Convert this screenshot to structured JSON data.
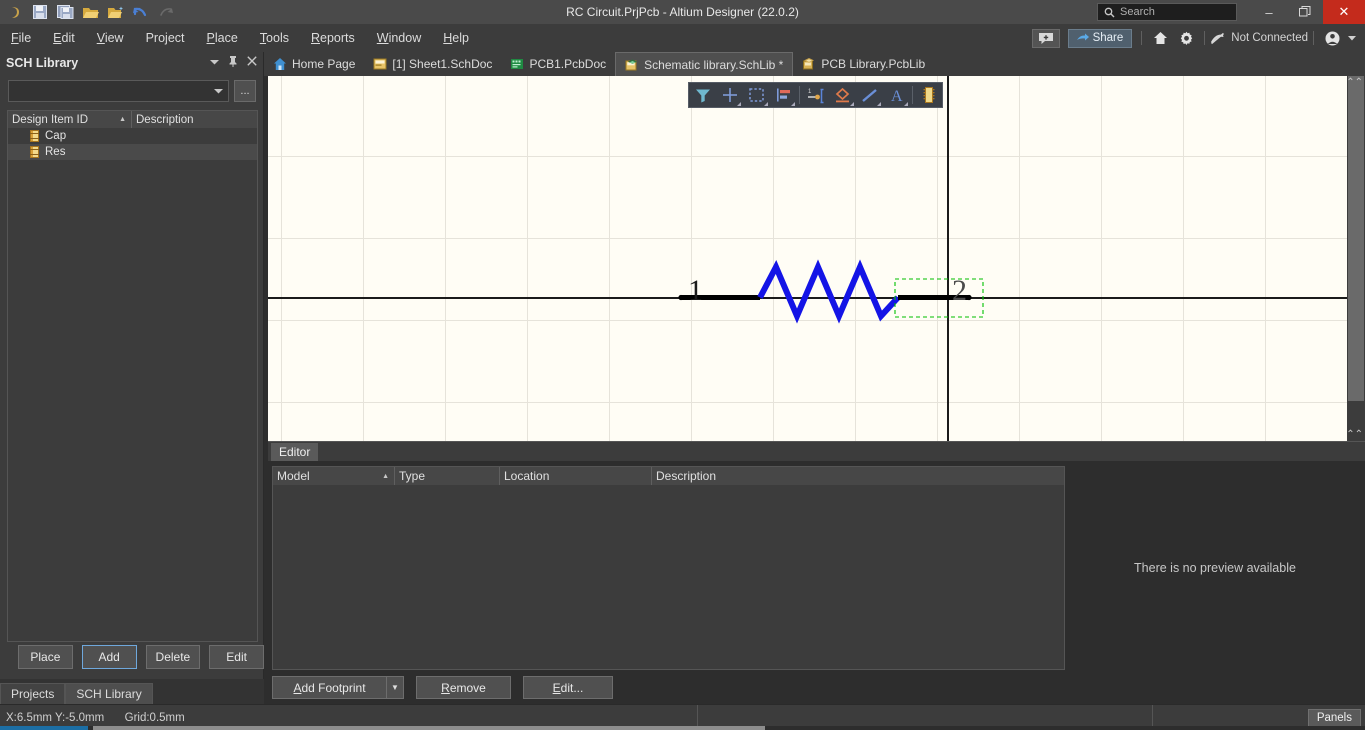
{
  "titlebar": {
    "title": "RC Circuit.PrjPcb - Altium Designer (22.0.2)",
    "search_placeholder": "Search",
    "quick_access": [
      {
        "name": "altium-logo-icon",
        "label": "A"
      },
      {
        "name": "save-icon",
        "label": "Save"
      },
      {
        "name": "save-all-icon",
        "label": "Save All"
      },
      {
        "name": "open-icon",
        "label": "Open"
      },
      {
        "name": "open-project-icon",
        "label": "Open Project"
      },
      {
        "name": "undo-icon",
        "label": "Undo"
      },
      {
        "name": "redo-icon",
        "label": "Redo"
      }
    ],
    "minimize": "–",
    "restore": "❐",
    "close": "✕"
  },
  "menubar": {
    "items": [
      {
        "label": "File",
        "mnemonic": "F"
      },
      {
        "label": "Edit",
        "mnemonic": "E"
      },
      {
        "label": "View",
        "mnemonic": "V"
      },
      {
        "label": "Project",
        "mnemonic": "j"
      },
      {
        "label": "Place",
        "mnemonic": "P"
      },
      {
        "label": "Tools",
        "mnemonic": "T"
      },
      {
        "label": "Reports",
        "mnemonic": "R"
      },
      {
        "label": "Window",
        "mnemonic": "W"
      },
      {
        "label": "Help",
        "mnemonic": "H"
      }
    ],
    "share_label": "Share",
    "connection_status": "Not Connected",
    "icons": [
      "add-panel-icon",
      "share-icon",
      "home-icon",
      "gear-icon",
      "not-connected-icon",
      "account-icon",
      "chevron-down-icon"
    ]
  },
  "tabs": [
    {
      "label": "Home Page",
      "icon": "home-page-icon",
      "active": false
    },
    {
      "label": "[1] Sheet1.SchDoc",
      "icon": "schematic-doc-icon",
      "active": false
    },
    {
      "label": "PCB1.PcbDoc",
      "icon": "pcb-doc-icon",
      "active": false
    },
    {
      "label": "Schematic library.SchLib *",
      "icon": "schlib-icon",
      "active": true
    },
    {
      "label": "PCB Library.PcbLib",
      "icon": "pcblib-icon",
      "active": false
    }
  ],
  "sidebar": {
    "title": "SCH Library",
    "header_icons": [
      "chevron-down-icon",
      "pin-icon",
      "close-icon"
    ],
    "library_select_value": "",
    "ellipsis_label": "...",
    "columns": [
      {
        "label": "Design Item ID",
        "sorted": true
      },
      {
        "label": "Description",
        "sorted": false
      }
    ],
    "items": [
      {
        "label": "Cap",
        "description": "",
        "selected": false
      },
      {
        "label": "Res",
        "description": "",
        "selected": true
      }
    ],
    "buttons": [
      {
        "label": "Place",
        "focused": false
      },
      {
        "label": "Add",
        "focused": true
      },
      {
        "label": "Delete",
        "focused": false
      },
      {
        "label": "Edit",
        "focused": false
      }
    ],
    "tabs": [
      {
        "label": "Projects",
        "active": false
      },
      {
        "label": "SCH Library",
        "active": true
      }
    ]
  },
  "canvas": {
    "toolbar_icons": [
      {
        "name": "filter-icon",
        "has_dropdown": false
      },
      {
        "name": "crosshair-place-icon",
        "has_dropdown": true
      },
      {
        "name": "selection-rectangle-icon",
        "has_dropdown": true
      },
      {
        "name": "align-icon",
        "has_dropdown": true
      },
      {
        "name": "place-pin-icon",
        "has_dropdown": false
      },
      {
        "name": "place-polygon-icon",
        "has_dropdown": true
      },
      {
        "name": "place-line-icon",
        "has_dropdown": true
      },
      {
        "name": "place-text-icon",
        "has_dropdown": true
      },
      {
        "name": "place-component-icon",
        "has_dropdown": false
      }
    ],
    "pin_labels": [
      "1",
      "2"
    ],
    "symbol_name": "resistor-symbol",
    "symbol_color": "#1414e6",
    "wire_color": "#000000",
    "selection_color": "#00c000",
    "background": "#fffdf5",
    "grid_color": "#e6e3da"
  },
  "editor": {
    "tab_label": "Editor",
    "model_columns": [
      "Model",
      "Type",
      "Location",
      "Description"
    ],
    "model_rows": [],
    "buttons": [
      {
        "label": "Add Footprint",
        "mnemonic": "A",
        "has_dropdown": true
      },
      {
        "label": "Remove",
        "mnemonic": "R",
        "has_dropdown": false
      },
      {
        "label": "Edit...",
        "mnemonic": "E",
        "has_dropdown": false
      }
    ],
    "preview_message": "There is no preview available"
  },
  "statusbar": {
    "coords": "X:6.5mm Y:-5.0mm",
    "grid": "Grid:0.5mm",
    "panels_label": "Panels"
  }
}
